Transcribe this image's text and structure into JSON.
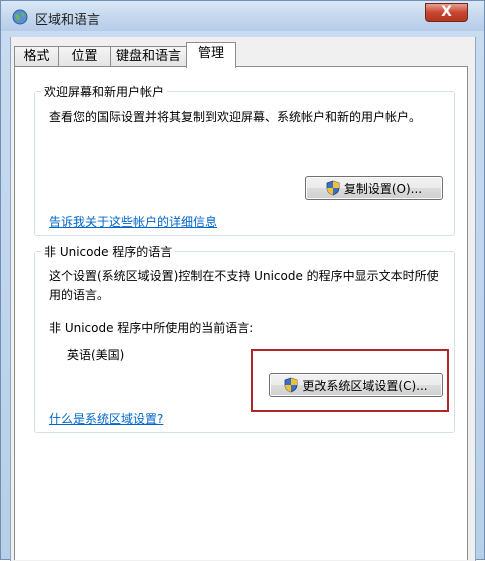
{
  "window": {
    "title": "区域和语言",
    "close_label": "X"
  },
  "tabs": [
    {
      "label": "格式"
    },
    {
      "label": "位置"
    },
    {
      "label": "键盘和语言"
    },
    {
      "label": "管理"
    }
  ],
  "welcome_group": {
    "title": "欢迎屏幕和新用户帐户",
    "description": "查看您的国际设置并将其复制到欢迎屏幕、系统帐户和新的用户帐户。",
    "copy_button": "复制设置(O)...",
    "info_link": "告诉我关于这些帐户的详细信息"
  },
  "unicode_group": {
    "title": "非 Unicode 程序的语言",
    "description_line1": "这个设置(系统区域设置)控制在不支持 Unicode 的程序中显示文本时所使",
    "description_line2": "用的语言。",
    "current_label": "非 Unicode 程序中所使用的当前语言:",
    "current_value": "英语(美国)",
    "change_button": "更改系统区域设置(C)...",
    "help_link": "什么是系统区域设置?"
  },
  "colors": {
    "highlight": "#b0262b",
    "link": "#0066cc"
  }
}
